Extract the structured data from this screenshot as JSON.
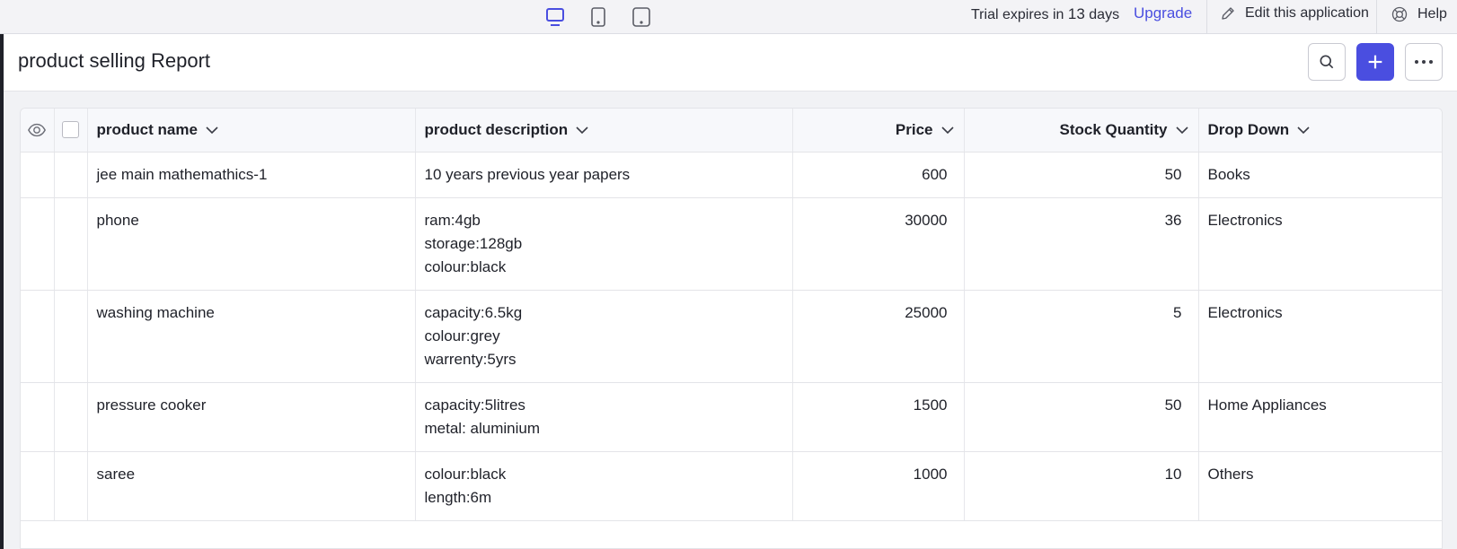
{
  "topbar": {
    "devices": [
      {
        "name": "desktop-view-icon",
        "active": true
      },
      {
        "name": "tablet-view-icon",
        "active": false
      },
      {
        "name": "mobile-view-icon",
        "active": false
      }
    ],
    "trial_prefix": "Trial expires in",
    "trial_days": "13",
    "trial_suffix": "days",
    "upgrade_label": "Upgrade",
    "edit_label": "Edit this application",
    "help_label": "Help"
  },
  "page": {
    "title": "product selling Report"
  },
  "colors": {
    "accent": "#4a4ee0",
    "active_device": "#4a4ee0"
  },
  "table": {
    "columns": [
      {
        "label": "product name",
        "align": "left"
      },
      {
        "label": "product description",
        "align": "left"
      },
      {
        "label": "Price",
        "align": "right"
      },
      {
        "label": "Stock Quantity",
        "align": "right"
      },
      {
        "label": "Drop Down",
        "align": "left"
      }
    ],
    "rows": [
      {
        "name": "jee main mathemathics-1",
        "description": [
          "10 years previous year papers"
        ],
        "price": "600",
        "stock": "50",
        "dropdown": "Books"
      },
      {
        "name": "phone",
        "description": [
          "ram:4gb",
          "storage:128gb",
          "colour:black"
        ],
        "price": "30000",
        "stock": "36",
        "dropdown": "Electronics"
      },
      {
        "name": "washing machine",
        "description": [
          "capacity:6.5kg",
          "colour:grey",
          "warrenty:5yrs"
        ],
        "price": "25000",
        "stock": "5",
        "dropdown": "Electronics"
      },
      {
        "name": "pressure cooker",
        "description": [
          "capacity:5litres",
          "metal: aluminium"
        ],
        "price": "1500",
        "stock": "50",
        "dropdown": "Home Appliances"
      },
      {
        "name": "saree",
        "description": [
          "colour:black",
          "length:6m"
        ],
        "price": "1000",
        "stock": "10",
        "dropdown": "Others"
      }
    ]
  }
}
